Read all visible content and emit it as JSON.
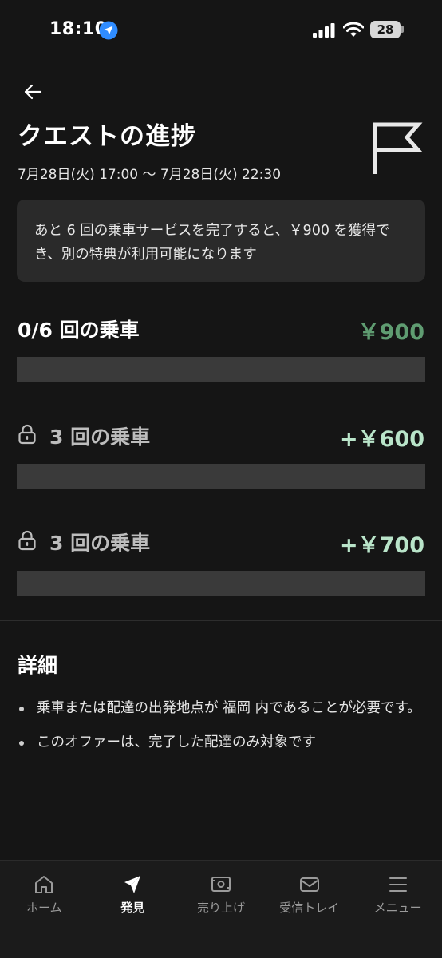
{
  "status_bar": {
    "time": "18:10",
    "battery": "28"
  },
  "header": {
    "title": "クエストの進捗",
    "date_range": "7月28日(火) 17:00 〜 7月28日(火) 22:30"
  },
  "info_card": {
    "text": "あと 6 回の乗車サービスを完了すると、￥900 を獲得でき、別の特典が利用可能になります"
  },
  "progress": {
    "main": {
      "label": "0/6 回の乗車",
      "amount": "￥900",
      "fraction": 0.0
    },
    "tiers": [
      {
        "label": "3 回の乗車",
        "amount": "+￥600",
        "locked": true,
        "fraction": 0.0
      },
      {
        "label": "3 回の乗車",
        "amount": "+￥700",
        "locked": true,
        "fraction": 0.0
      }
    ]
  },
  "details": {
    "title": "詳細",
    "items": [
      "乗車または配達の出発地点が 福岡 内であることが必要です。",
      "このオファーは、完了した配達のみ対象です"
    ]
  },
  "bottom_nav": {
    "items": [
      {
        "label": "ホーム",
        "icon": "home-icon",
        "active": false
      },
      {
        "label": "発見",
        "icon": "discover-icon",
        "active": true
      },
      {
        "label": "売り上げ",
        "icon": "earnings-icon",
        "active": false
      },
      {
        "label": "受信トレイ",
        "icon": "inbox-icon",
        "active": false
      },
      {
        "label": "メニュー",
        "icon": "menu-icon",
        "active": false
      }
    ]
  },
  "colors": {
    "background": "#151515",
    "card": "#2a2a2a",
    "bar_track": "#3a3a3a",
    "main_amount": "#5f9c71",
    "tier_amount": "#b9e4c9",
    "muted_text": "#bdbdbd"
  }
}
